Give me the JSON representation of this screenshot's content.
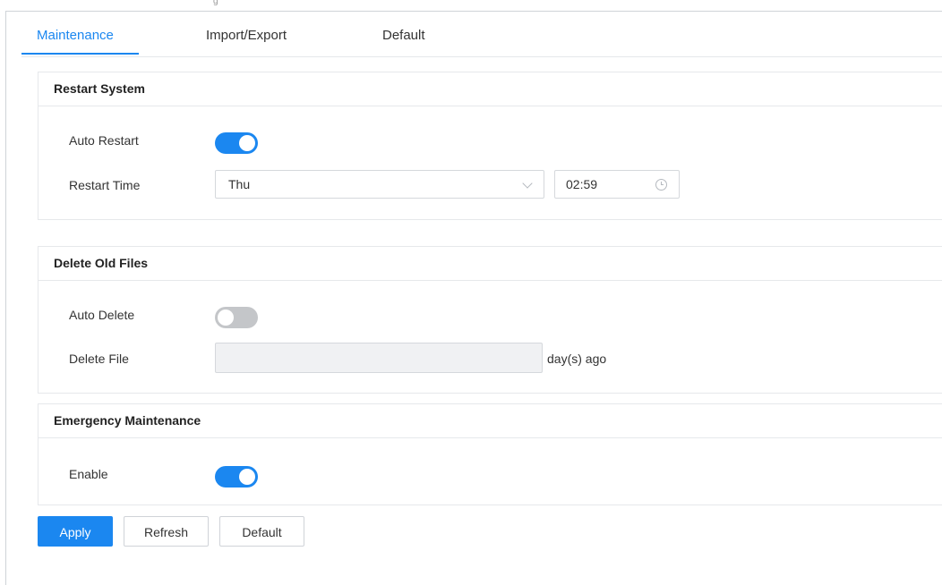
{
  "top_fragment": "g",
  "tabs": [
    {
      "label": "Maintenance",
      "active": true
    },
    {
      "label": "Import/Export",
      "active": false
    },
    {
      "label": "Default",
      "active": false
    }
  ],
  "restart": {
    "title": "Restart System",
    "auto_label": "Auto Restart",
    "auto_enabled": true,
    "time_label": "Restart Time",
    "day_value": "Thu",
    "time_value": "02:59"
  },
  "delete": {
    "title": "Delete Old Files",
    "auto_label": "Auto Delete",
    "auto_enabled": false,
    "file_label": "Delete File",
    "file_value": "",
    "suffix": "day(s) ago"
  },
  "emergency": {
    "title": "Emergency Maintenance",
    "enable_label": "Enable",
    "enabled": true
  },
  "buttons": {
    "apply": "Apply",
    "refresh": "Refresh",
    "default": "Default"
  },
  "colors": {
    "accent": "#1b87f0",
    "toggle_off": "#c4c6c9",
    "disabled_bg": "#f0f1f3"
  },
  "icons": {
    "select_arrow": "chevron-down-icon",
    "time_picker": "clock-icon"
  }
}
